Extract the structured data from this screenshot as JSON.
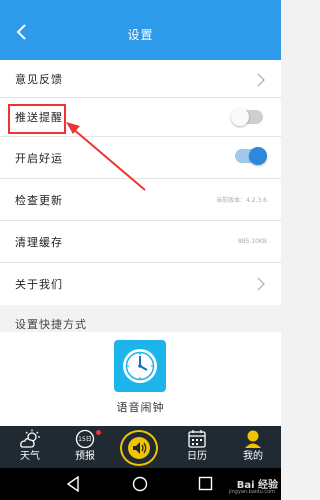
{
  "header": {
    "title": "设置",
    "back_icon": "chevron-left-icon"
  },
  "settings": {
    "feedback": {
      "label": "意见反馈"
    },
    "push": {
      "label": "推送提醒",
      "enabled": false
    },
    "luck": {
      "label": "开启好运",
      "enabled": true
    },
    "update": {
      "label": "检查更新",
      "value": "当前版本：4.2.3.6"
    },
    "cache": {
      "label": "清理缓存",
      "value": "885.10KB"
    },
    "about": {
      "label": "关于我们"
    }
  },
  "shortcut": {
    "title": "设置快捷方式",
    "item_label": "语音闹钟",
    "item_icon": "alarm-clock-icon"
  },
  "tabs": {
    "weather": {
      "label": "天气",
      "icon": "weather-icon"
    },
    "forecast": {
      "label": "预报",
      "icon": "forecast-icon",
      "badge_value": "15日"
    },
    "center": {
      "icon": "speaker-icon"
    },
    "calendar": {
      "label": "日历",
      "icon": "calendar-icon"
    },
    "mine": {
      "label": "我的",
      "icon": "user-icon"
    }
  },
  "watermark": {
    "text": "Bai 经验",
    "url": "jingyan.baidu.com"
  },
  "colors": {
    "accent": "#2e9bea",
    "toggle_on": "#2f86dd",
    "highlight": "#e33333",
    "tabbar": "#202a33",
    "center_ring": "#f0c400"
  }
}
